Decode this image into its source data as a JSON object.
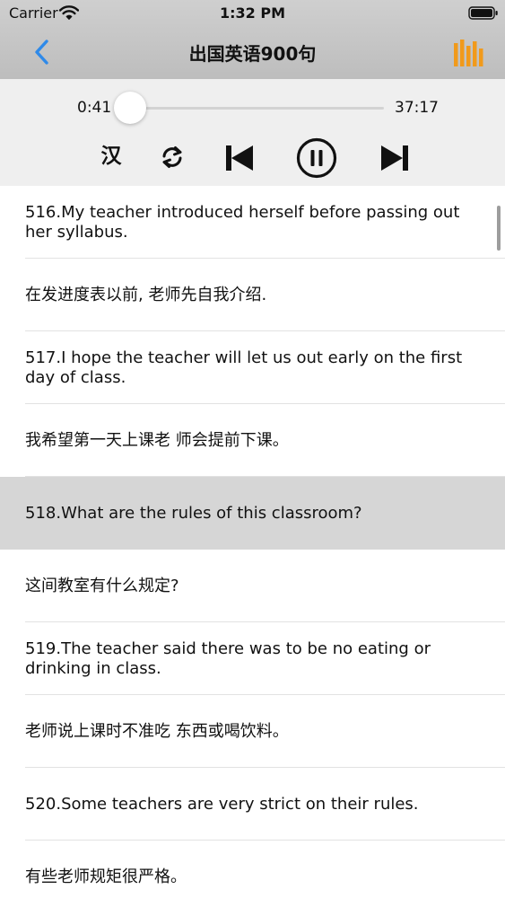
{
  "status_bar": {
    "carrier": "Carrier",
    "time": "1:32 PM"
  },
  "nav": {
    "title": "出国英语900句",
    "back_icon": "chevron-left-icon",
    "playlist_icon": "playlist-bars-icon",
    "accent_color": "#2f8ae9",
    "playlist_color": "#f19a1b"
  },
  "player": {
    "elapsed": "0:41",
    "total": "37:17",
    "progress_fraction": 0.018,
    "language_toggle": "汉",
    "controls": [
      "repeat-icon",
      "previous-track-icon",
      "pause-icon",
      "next-track-icon"
    ]
  },
  "sentences": [
    {
      "text": "516.My teacher introduced herself before passing out her syllabus.",
      "highlighted": false
    },
    {
      "text": "在发进度表以前, 老师先自我介绍.",
      "highlighted": false
    },
    {
      "text": "517.I hope the teacher will let us out early on the first day of class.",
      "highlighted": false
    },
    {
      "text": "我希望第一天上课老 师会提前下课。",
      "highlighted": false
    },
    {
      "text": "518.What are the rules of this classroom?",
      "highlighted": true
    },
    {
      "text": "这间教室有什么规定?",
      "highlighted": false
    },
    {
      "text": "519.The teacher said there was to be no eating or drinking in class.",
      "highlighted": false
    },
    {
      "text": "老师说上课时不准吃 东西或喝饮料。",
      "highlighted": false
    },
    {
      "text": "520.Some teachers are very strict on their rules.",
      "highlighted": false
    },
    {
      "text": "有些老师规矩很严格。",
      "highlighted": false
    }
  ]
}
